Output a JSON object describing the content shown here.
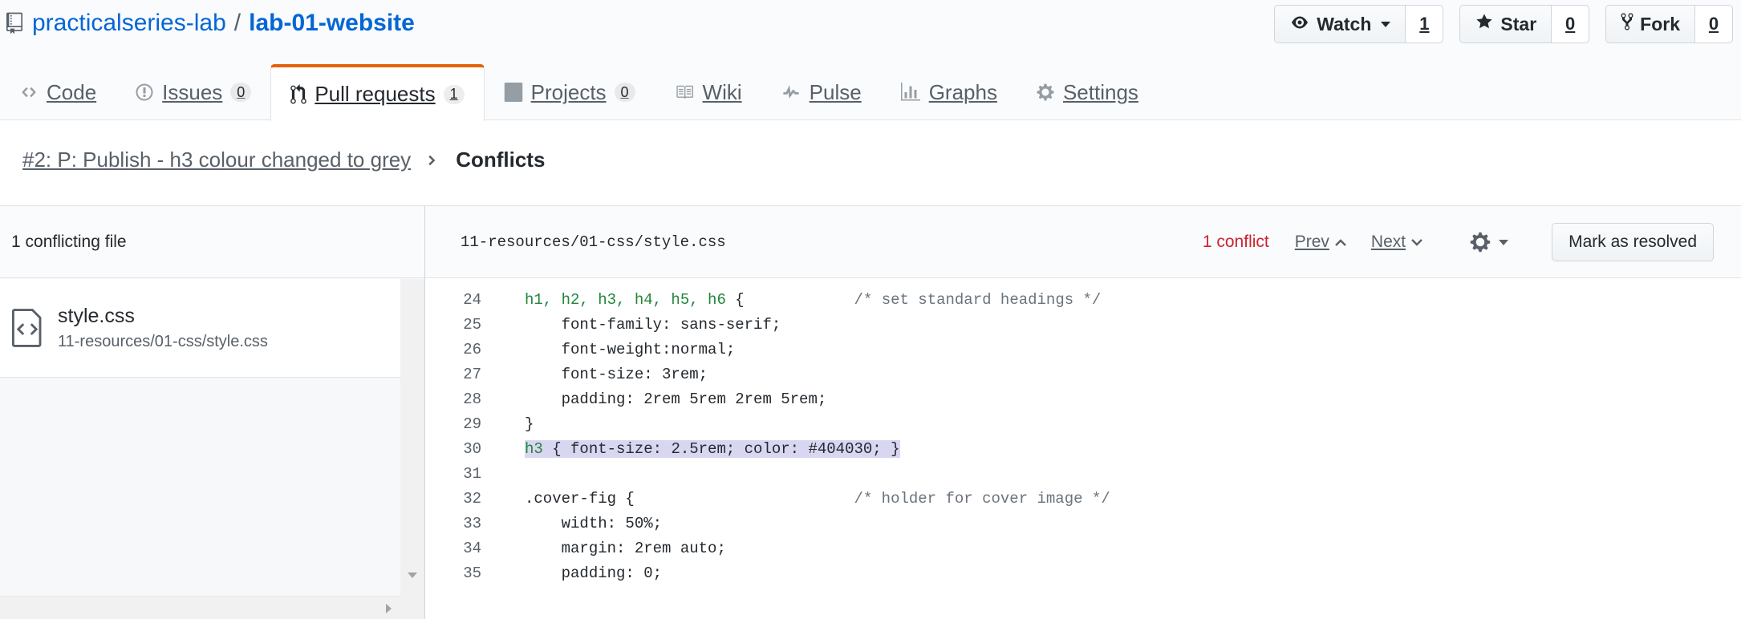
{
  "repo": {
    "owner": "practicalseries-lab",
    "separator": "/",
    "name": "lab-01-website"
  },
  "actions": {
    "watch": {
      "label": "Watch",
      "count": "1"
    },
    "star": {
      "label": "Star",
      "count": "0"
    },
    "fork": {
      "label": "Fork",
      "count": "0"
    }
  },
  "tabs": [
    {
      "label": "Code",
      "icon": "code-icon"
    },
    {
      "label": "Issues",
      "icon": "issue-icon",
      "counter": "0"
    },
    {
      "label": "Pull requests",
      "icon": "pull-request-icon",
      "counter": "1",
      "selected": true
    },
    {
      "label": "Projects",
      "icon": "project-icon",
      "counter": "0"
    },
    {
      "label": "Wiki",
      "icon": "book-icon"
    },
    {
      "label": "Pulse",
      "icon": "pulse-icon"
    },
    {
      "label": "Graphs",
      "icon": "graph-icon"
    },
    {
      "label": "Settings",
      "icon": "gear-icon"
    }
  ],
  "breadcrumb": {
    "pull_request": "#2: P: Publish - h3 colour changed to grey",
    "current": "Conflicts"
  },
  "sidebar": {
    "header": "1 conflicting file",
    "files": [
      {
        "name": "style.css",
        "path": "11-resources/01-css/style.css"
      }
    ]
  },
  "editor": {
    "file_path": "11-resources/01-css/style.css",
    "conflict_count": "1 conflict",
    "prev_label": "Prev",
    "next_label": "Next",
    "resolve_label": "Mark as resolved",
    "lines": [
      {
        "n": "24",
        "parts": [
          [
            "sel",
            "h1, h2, h3, h4, h5, h6"
          ],
          [
            "",
            " {            "
          ],
          [
            "cmt",
            "/* set standard headings */"
          ]
        ]
      },
      {
        "n": "25",
        "parts": [
          [
            "",
            "    font-family: sans-serif;"
          ]
        ]
      },
      {
        "n": "26",
        "parts": [
          [
            "",
            "    font-weight:normal;"
          ]
        ]
      },
      {
        "n": "27",
        "parts": [
          [
            "",
            "    font-size: 3rem;"
          ]
        ]
      },
      {
        "n": "28",
        "parts": [
          [
            "",
            "    padding: 2rem 5rem 2rem 5rem;"
          ]
        ]
      },
      {
        "n": "29",
        "parts": [
          [
            "",
            "}"
          ]
        ]
      },
      {
        "n": "30",
        "highlight": true,
        "parts": [
          [
            "sel",
            "h3"
          ],
          [
            "",
            " { font-size: 2.5rem; color: #404030; }"
          ]
        ]
      },
      {
        "n": "31",
        "parts": [
          [
            "",
            ""
          ]
        ]
      },
      {
        "n": "32",
        "parts": [
          [
            "",
            ".cover-fig {                        "
          ],
          [
            "cmt",
            "/* holder for cover image */"
          ]
        ]
      },
      {
        "n": "33",
        "parts": [
          [
            "",
            "    width: 50%;"
          ]
        ]
      },
      {
        "n": "34",
        "parts": [
          [
            "",
            "    margin: 2rem auto;"
          ]
        ]
      },
      {
        "n": "35",
        "parts": [
          [
            "",
            "    padding: 0;"
          ]
        ]
      }
    ]
  },
  "colors": {
    "link": "#0366d6",
    "tab_accent": "#e36209",
    "conflict": "#cb2431",
    "selector": "#22863a",
    "comment": "#6a737d",
    "highlight": "#d9d6f2"
  }
}
